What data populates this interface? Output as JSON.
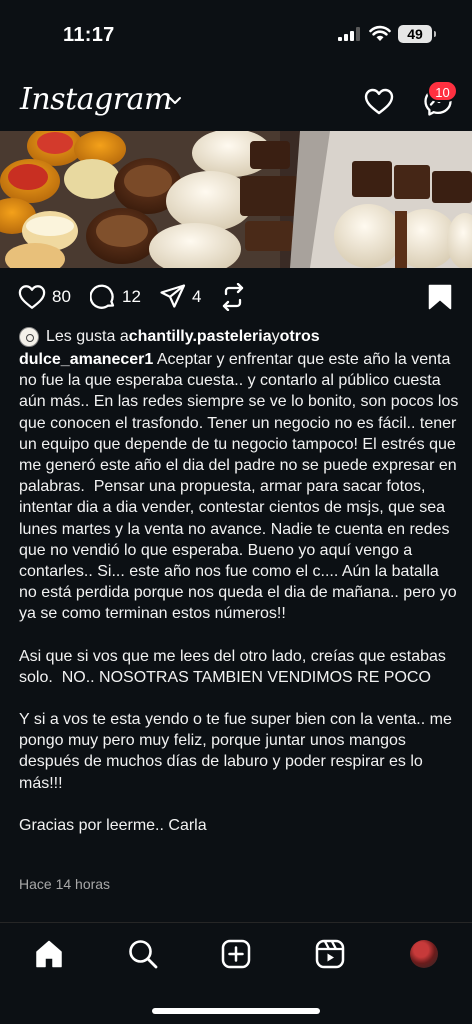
{
  "status_bar": {
    "time": "11:17",
    "battery": "49"
  },
  "header": {
    "logo": "Instagram",
    "notification_badge": "10"
  },
  "post": {
    "likes_count": "80",
    "comments_count": "12",
    "shares_count": "4",
    "liked_by_prefix": "Les gusta a ",
    "liked_by_user": "chantilly.pasteleria",
    "liked_by_join": " y ",
    "liked_by_others": "otros",
    "username": "dulce_amanecer1",
    "caption_p1": " Aceptar y enfrentar que este año la venta no fue la que esperaba cuesta.. y contarlo al público cuesta aún más.. En las redes siempre se ve lo bonito, son pocos los que conocen el trasfondo. Tener un negocio no es fácil.. tener un equipo que depende de tu negocio tampoco! El estrés que me generó este año el dia del padre no se puede expresar en palabras.  Pensar una propuesta, armar para sacar fotos, intentar dia a dia vender, contestar cientos de msjs, que sea lunes martes y la venta no avance. Nadie te cuenta en redes que no vendió lo que esperaba. Bueno yo aquí vengo a contarles.. Si... este año nos fue como el c.... Aún la batalla no está perdida porque nos queda el dia de mañana.. pero yo ya se como terminan estos números!!",
    "caption_p2": "Asi que si vos que me lees del otro lado, creías que estabas solo.  NO.. NOSOTRAS TAMBIEN VENDIMOS RE POCO",
    "caption_p3": "Y si a vos te esta yendo o te fue super bien con la venta.. me pongo muy pero muy feliz, porque juntar unos mangos después de muchos días de laburo y poder respirar es lo más!!!",
    "caption_p4": "Gracias por leerme.. Carla",
    "timestamp": "Hace 14 horas"
  },
  "colors": {
    "background": "#0c1014",
    "badge": "#ff3040",
    "text": "#f2f2f2",
    "muted": "#a8a8a8"
  }
}
